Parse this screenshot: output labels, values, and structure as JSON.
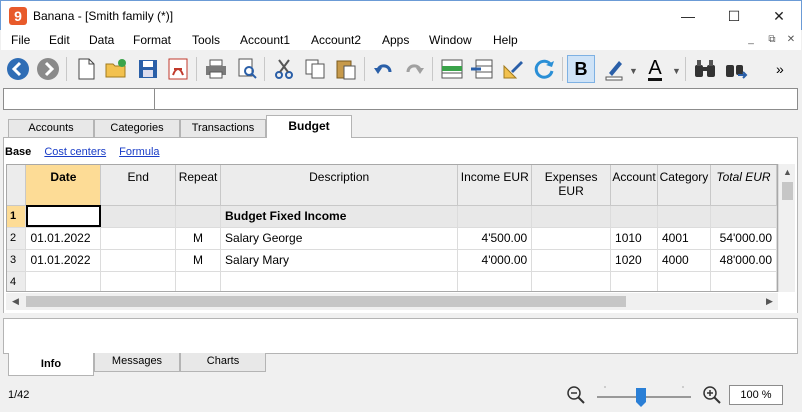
{
  "window": {
    "title": "Banana - [Smith family (*)]",
    "logo_text": "9",
    "minimize": "—",
    "maximize": "☐",
    "close": "✕"
  },
  "menu": [
    "File",
    "Edit",
    "Data",
    "Format",
    "Tools",
    "Account1",
    "Account2",
    "Apps",
    "Window",
    "Help"
  ],
  "mdi_controls": [
    "_",
    "⧉",
    "✕"
  ],
  "toolbar": {
    "bold_label": "B",
    "overflow": "»",
    "font_color_label": "A"
  },
  "main_tabs": [
    "Accounts",
    "Categories",
    "Transactions",
    "Budget"
  ],
  "views": {
    "base": "Base",
    "links": [
      "Cost centers",
      "Formula"
    ]
  },
  "grid": {
    "columns": [
      "Date",
      "End",
      "Repeat",
      "Description",
      "Income EUR",
      "Expenses EUR",
      "Account",
      "Category",
      "Total EUR"
    ],
    "rows": [
      {
        "n": "1",
        "date": "",
        "end": "",
        "repeat": "",
        "description": "Budget Fixed Income",
        "income": "",
        "expenses": "",
        "account": "",
        "category": "",
        "total": ""
      },
      {
        "n": "2",
        "date": "01.01.2022",
        "end": "",
        "repeat": "M",
        "description": "Salary George",
        "income": "4'500.00",
        "expenses": "",
        "account": "1010",
        "category": "4001",
        "total": "54'000.00"
      },
      {
        "n": "3",
        "date": "01.01.2022",
        "end": "",
        "repeat": "M",
        "description": "Salary Mary",
        "income": "4'000.00",
        "expenses": "",
        "account": "1020",
        "category": "4000",
        "total": "48'000.00"
      },
      {
        "n": "4",
        "date": "",
        "end": "",
        "repeat": "",
        "description": "",
        "income": "",
        "expenses": "",
        "account": "",
        "category": "",
        "total": ""
      }
    ]
  },
  "bottom_tabs": [
    "Info",
    "Messages",
    "Charts"
  ],
  "status": {
    "position": "1/42",
    "zoom": "100 %",
    "zoom_level": 0.5
  }
}
